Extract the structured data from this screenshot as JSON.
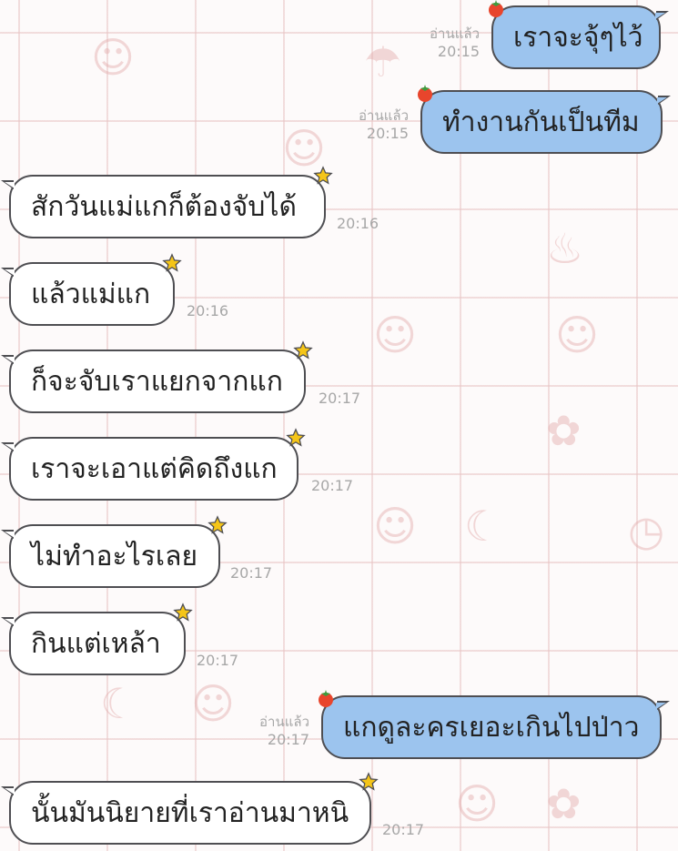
{
  "chat": {
    "read_label": "อ่านแล้ว",
    "messages": [
      {
        "side": "out",
        "text": "เราจะจุ้ๆไว้",
        "time": "20:15",
        "read": "อ่านแล้ว"
      },
      {
        "side": "out",
        "text": "ทำงานกันเป็นทีม",
        "time": "20:15",
        "read": "อ่านแล้ว"
      },
      {
        "side": "in",
        "text": "สักวันแม่แกก็ต้องจับได้",
        "time": "20:16"
      },
      {
        "side": "in",
        "text": "แล้วแม่แก",
        "time": "20:16"
      },
      {
        "side": "in",
        "text": "ก็จะจับเราแยกจากแก",
        "time": "20:17"
      },
      {
        "side": "in",
        "text": "เราจะเอาแต่คิดถึงแก",
        "time": "20:17"
      },
      {
        "side": "in",
        "text": "ไม่ทำอะไรเลย",
        "time": "20:17"
      },
      {
        "side": "in",
        "text": "กินแต่เหล้า",
        "time": "20:17"
      },
      {
        "side": "out",
        "text": "แกดูละครเยอะเกินไปป่าว",
        "time": "20:17",
        "read": "อ่านแล้ว"
      },
      {
        "side": "in",
        "text": "นั้นมันนิยายที่เราอ่านมาหนิ",
        "time": "20:17"
      }
    ]
  },
  "colors": {
    "outgoing_bubble": "#9cc4ee",
    "incoming_bubble": "#ffffff",
    "bubble_border": "#4e4e52",
    "timestamp": "#a7a7a7",
    "background_grid": "#e8c4c4",
    "star_badge": "#f5c518",
    "tomato_badge": "#e8452c"
  },
  "icons": {
    "incoming_badge": "star-icon",
    "outgoing_badge": "tomato-icon"
  }
}
